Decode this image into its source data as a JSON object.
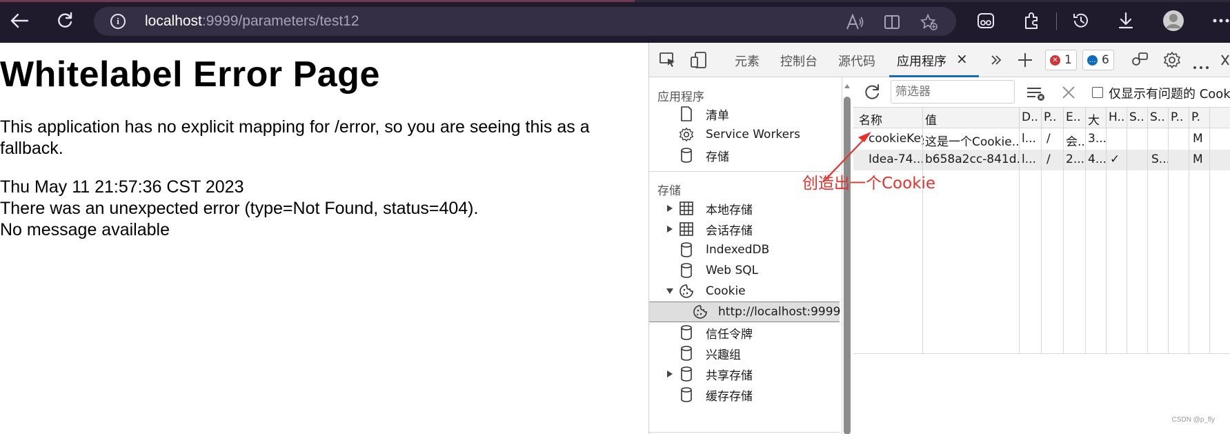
{
  "browser": {
    "url_host": "localhost",
    "url_rest": ":9999/parameters/test12"
  },
  "page": {
    "heading": "Whitelabel Error Page",
    "line1": "This application has no explicit mapping for /error, so you are seeing this as a fallback.",
    "line2": "Thu May 11 21:57:36 CST 2023",
    "line3": "There was an unexpected error (type=Not Found, status=404).",
    "line4": "No message available"
  },
  "devtools": {
    "tabs": [
      "元素",
      "控制台",
      "源代码",
      "应用程序"
    ],
    "close_glyph": "×",
    "errors_count": "1",
    "messages_count": "6",
    "sidebar": {
      "app_section": "应用程序",
      "app_items": [
        "清单",
        "Service Workers",
        "存储"
      ],
      "storage_section": "存储",
      "storage_items": [
        "本地存储",
        "会话存储",
        "IndexedDB",
        "Web SQL",
        "Cookie",
        "http://localhost:9999",
        "信任令牌",
        "兴趣组",
        "共享存储",
        "缓存存储"
      ]
    },
    "cookies": {
      "filter_placeholder": "筛选器",
      "only_issues_label": "仅显示有问题的 Cook",
      "columns": [
        "名称",
        "值",
        "D..",
        "P..",
        "E..",
        "大",
        "H..",
        "S..",
        "S..",
        "P..",
        "P."
      ],
      "rows": [
        [
          "cookieKey",
          "这是一个Cookie...",
          "l...",
          "/",
          "会..",
          "3...",
          "",
          "",
          "",
          "",
          "M"
        ],
        [
          "Idea-74...",
          "b658a2cc-841d...",
          "l...",
          "/",
          "2...",
          "4...",
          "✓",
          "",
          "S...",
          "",
          "M"
        ]
      ]
    }
  },
  "annotation": "创造出一个Cookie",
  "watermark": "CSDN @p_fly",
  "colors": {
    "annotation": "#e8302a",
    "tab_accent": "#0f6cbd",
    "error_badge": "#d13438",
    "message_badge": "#0f6cbd"
  }
}
